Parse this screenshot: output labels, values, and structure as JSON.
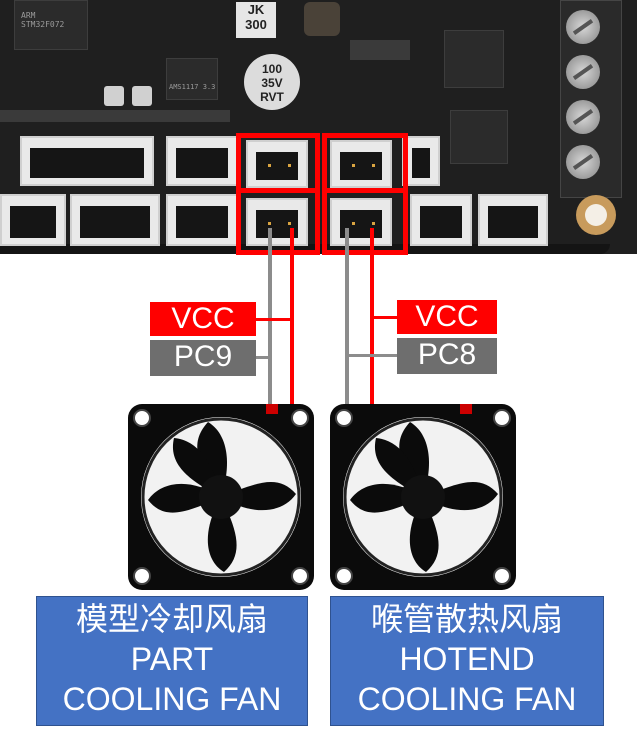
{
  "board": {
    "jk_marking": [
      "JK",
      "300"
    ],
    "capacitor_marking": [
      "100",
      "35V",
      "RVT"
    ],
    "regulator_marking": "AMS1117 3.3",
    "mcu_marking": [
      "ARM",
      "STM32F072"
    ]
  },
  "signals": {
    "left": {
      "power": "VCC",
      "pin": "PC9"
    },
    "right": {
      "power": "VCC",
      "pin": "PC8"
    }
  },
  "fans": [
    {
      "cn": "模型冷却风扇",
      "en_line1": "PART",
      "en_line2": "COOLING FAN"
    },
    {
      "cn": "喉管散热风扇",
      "en_line1": "HOTEND",
      "en_line2": "COOLING FAN"
    }
  ],
  "colors": {
    "highlight": "#ff0000",
    "signal_gray": "#6e6e6e",
    "caption_blue": "#4472c4"
  }
}
